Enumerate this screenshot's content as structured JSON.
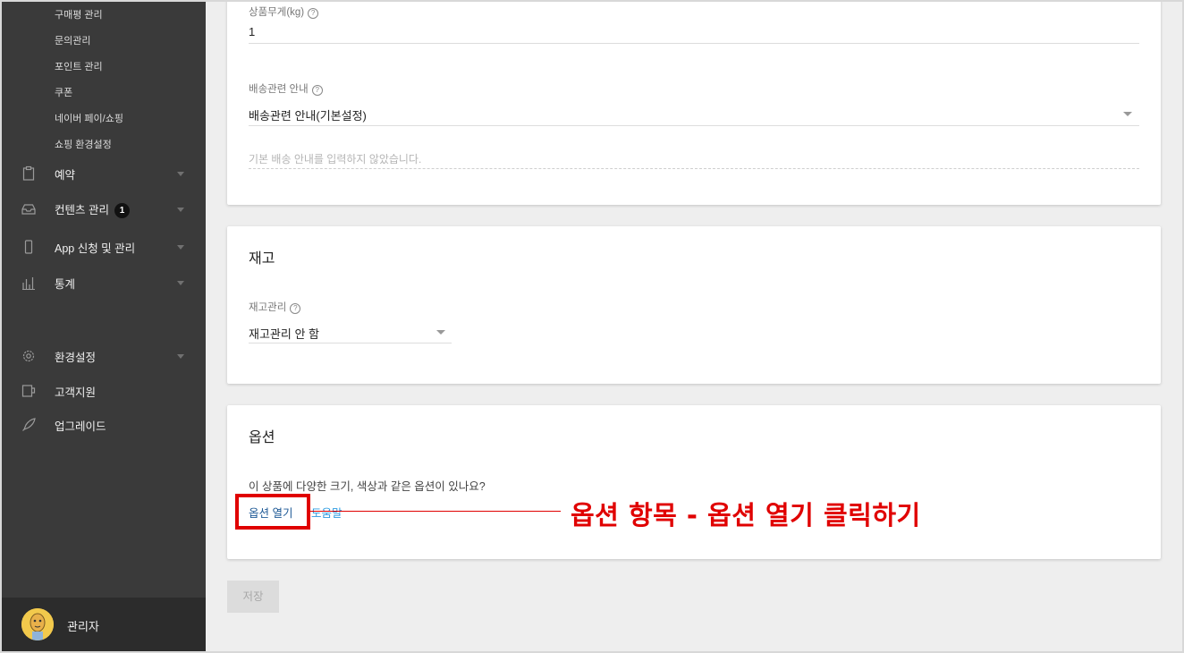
{
  "sidebar": {
    "sub_items": [
      "구매평 관리",
      "문의관리",
      "포인트 관리",
      "쿠폰",
      "네이버 페이/쇼핑",
      "쇼핑 환경설정"
    ],
    "nav": {
      "reservation": "예약",
      "contents": "컨텐츠 관리",
      "contents_badge": "1",
      "app": "App 신청 및 관리",
      "stats": "통계",
      "settings": "환경설정",
      "support": "고객지원",
      "upgrade": "업그레이드"
    },
    "user": {
      "name": "관리자"
    }
  },
  "shipping_card": {
    "weight_label": "상품무게(kg)",
    "weight_value": "1",
    "shipping_info_label": "배송관련 안내",
    "shipping_info_value": "배송관련 안내(기본설정)",
    "shipping_info_placeholder": "기본 배송 안내를 입력하지 않았습니다."
  },
  "inventory_card": {
    "title": "재고",
    "stock_label": "재고관리",
    "stock_value": "재고관리 안 함"
  },
  "options_card": {
    "title": "옵션",
    "question": "이 상품에 다양한 크기, 색상과 같은 옵션이 있나요?",
    "open_options": "옵션 열기",
    "help": "도움말"
  },
  "save_label": "저장",
  "annotation": {
    "text": "옵션 항목 - 옵션 열기 클릭하기",
    "color": "#e00000"
  },
  "help_glyph": "?"
}
